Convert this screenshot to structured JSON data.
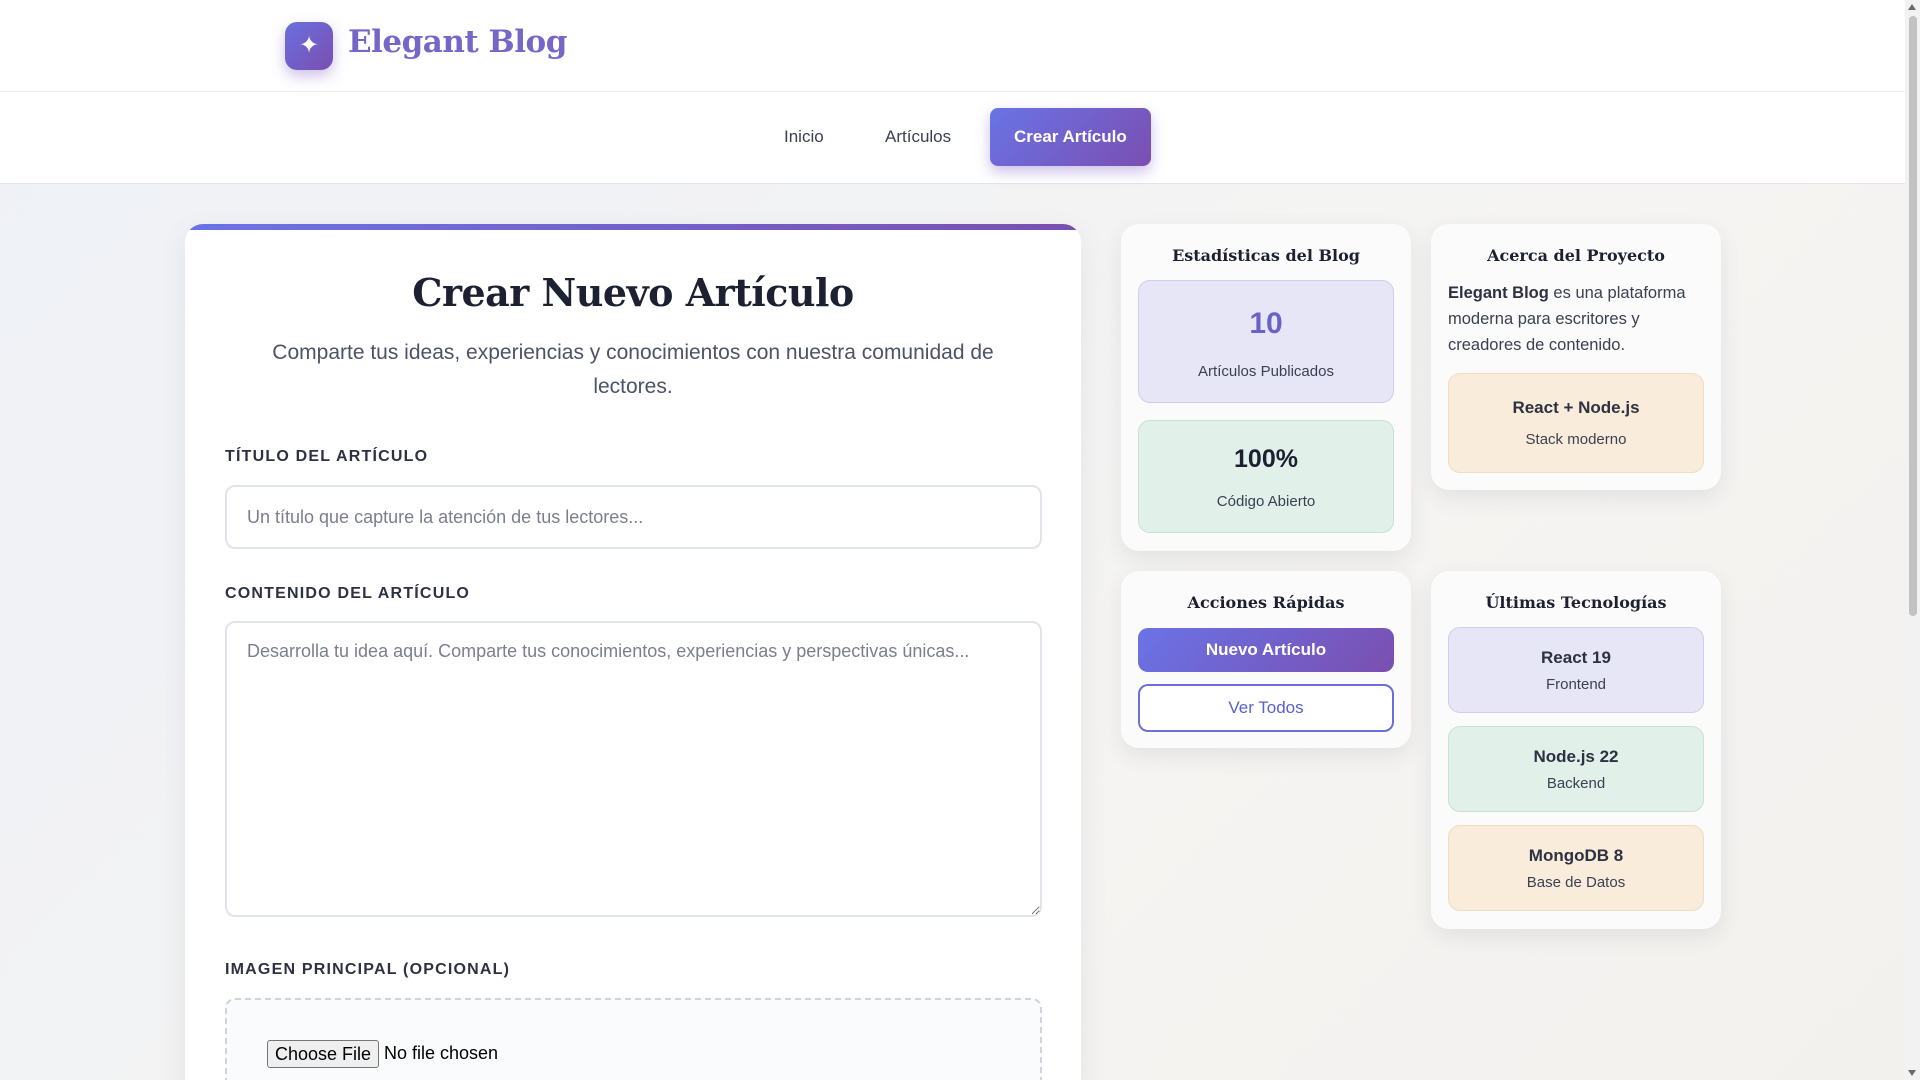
{
  "header": {
    "logo_glyph": "✦",
    "brand": "Elegant Blog"
  },
  "nav": {
    "items": [
      {
        "label": "Inicio",
        "active": false
      },
      {
        "label": "Artículos",
        "active": false
      },
      {
        "label": "Crear Artículo",
        "active": true
      }
    ]
  },
  "form": {
    "title": "Crear Nuevo Artículo",
    "subtitle": "Comparte tus ideas, experiencias y conocimientos con nuestra comunidad de lectores.",
    "title_label": "TÍTULO DEL ARTÍCULO",
    "title_placeholder": "Un título que capture la atención de tus lectores...",
    "content_label": "CONTENIDO DEL ARTÍCULO",
    "content_placeholder": "Desarrolla tu idea aquí. Comparte tus conocimientos, experiencias y perspectivas únicas...",
    "image_label": "IMAGEN PRINCIPAL (OPCIONAL)",
    "file_button": "Choose File",
    "file_status": "No file chosen"
  },
  "stats": {
    "title": "Estadísticas del Blog",
    "articles_count": "10",
    "articles_label": "Artículos Publicados",
    "open_source_value": "100%",
    "open_source_label": "Código Abierto"
  },
  "about": {
    "title": "Acerca del Proyecto",
    "brand_bold": "Elegant Blog",
    "description": " es una plataforma moderna para escritores y creadores de contenido.",
    "stack_name": "React + Node.js",
    "stack_sub": "Stack moderno"
  },
  "actions": {
    "title": "Acciones Rápidas",
    "new_article": "Nuevo Artículo",
    "view_all": "Ver Todos"
  },
  "tech": {
    "title": "Últimas Tecnologías",
    "items": [
      {
        "name": "React 19",
        "role": "Frontend"
      },
      {
        "name": "Node.js 22",
        "role": "Backend"
      },
      {
        "name": "MongoDB 8",
        "role": "Base de Datos"
      }
    ]
  },
  "colors": {
    "accent_start": "#6a73e6",
    "accent_end": "#7a4fb0"
  }
}
